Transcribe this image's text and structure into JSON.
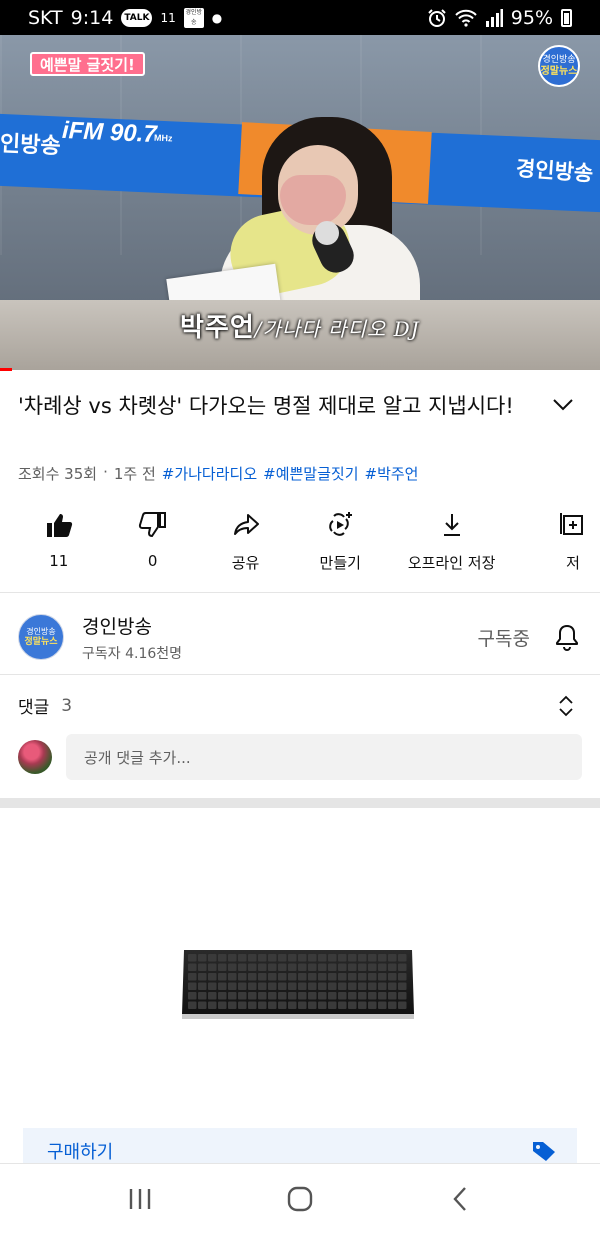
{
  "status_bar": {
    "carrier": "SKT",
    "time": "9:14",
    "talk_label": "TALK",
    "network_label": "11",
    "app_badge": "경인방송",
    "battery": "95%"
  },
  "video": {
    "corner_tag": "예쁜말 글짓기!",
    "logo_line1": "경인방송",
    "logo_line2": "정말뉴스",
    "banner_left": "인방송",
    "banner_fm": "iFM 90.7",
    "banner_fm_mhz": "MHz",
    "banner_right": "경인방송",
    "subtitle_name": "박주언",
    "subtitle_role": "/가나다 라디오 DJ",
    "progress": 0.02
  },
  "title": "'차례상 vs 차롓상' 다가오는 명절 제대로 알고 지냅시다!",
  "meta": {
    "views": "조회수 35회",
    "separator": "·",
    "age": "1주 전",
    "hashtags": [
      "#가나다라디오",
      "#예쁜말글짓기",
      "#박주언"
    ]
  },
  "actions": [
    {
      "label": "11",
      "icon": "thumbs-up-icon"
    },
    {
      "label": "0",
      "icon": "thumbs-down-icon"
    },
    {
      "label": "공유",
      "icon": "share-icon"
    },
    {
      "label": "만들기",
      "icon": "create-icon"
    },
    {
      "label": "오프라인 저장",
      "icon": "download-icon"
    },
    {
      "label": "저",
      "icon": "save-icon"
    }
  ],
  "channel": {
    "avatar_line1": "경인방송",
    "avatar_line2": "정말뉴스",
    "name": "경인방송",
    "subscribers": "구독자 4.16천명",
    "subscribe_state": "구독중"
  },
  "comments": {
    "label": "댓글",
    "count": "3",
    "placeholder": "공개 댓글 추가..."
  },
  "product": {
    "buy_label": "구매하기"
  },
  "colors": {
    "link_blue": "#065fd4",
    "progress_red": "#ff0000",
    "secondary_text": "#606060"
  }
}
